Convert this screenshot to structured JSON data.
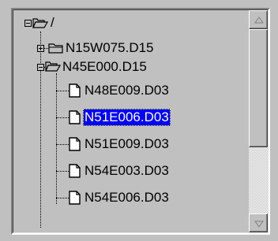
{
  "tree": {
    "nodes": [
      {
        "label": "/",
        "type": "folder-open",
        "expander": "minus",
        "level": 0
      },
      {
        "label": "N15W075.D15",
        "type": "folder-closed",
        "expander": "plus",
        "level": 1
      },
      {
        "label": "N45E000.D15",
        "type": "folder-open",
        "expander": "minus",
        "level": 1
      },
      {
        "label": "N48E009.D03",
        "type": "file",
        "expander": "none",
        "level": 2
      },
      {
        "label": "N51E006.D03",
        "type": "file",
        "expander": "none",
        "level": 2,
        "selected": true
      },
      {
        "label": "N51E009.D03",
        "type": "file",
        "expander": "none",
        "level": 2
      },
      {
        "label": "N54E003.D03",
        "type": "file",
        "expander": "none",
        "level": 2
      },
      {
        "label": "N54E006.D03",
        "type": "file",
        "expander": "none",
        "level": 2
      }
    ]
  },
  "scrollbar": {
    "position": 0.0,
    "visible_fraction": 0.62
  },
  "colors": {
    "background": "#c0c0c0",
    "selection": "#0000ff",
    "selection_text": "#ffffff"
  }
}
